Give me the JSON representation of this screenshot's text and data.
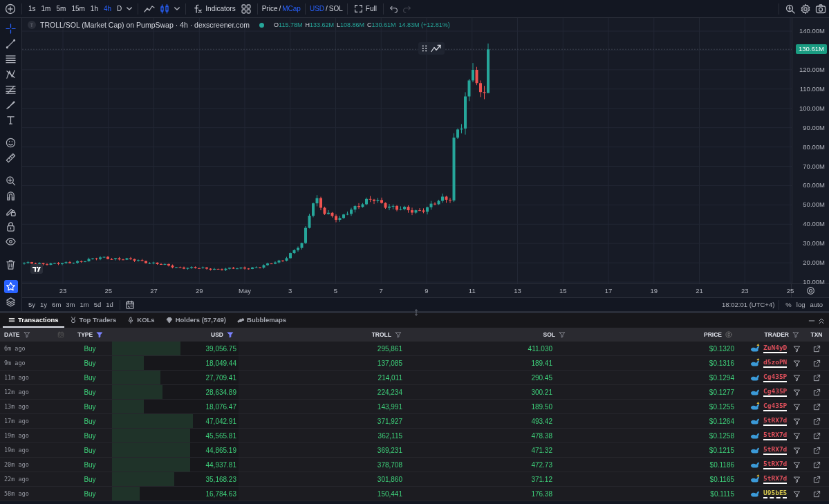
{
  "toolbar": {
    "intervals": [
      {
        "label": "1s",
        "selected": false
      },
      {
        "label": "1m",
        "selected": false
      },
      {
        "label": "5m",
        "selected": false
      },
      {
        "label": "15m",
        "selected": false
      },
      {
        "label": "1h",
        "selected": false
      },
      {
        "label": "4h",
        "selected": true
      },
      {
        "label": "D",
        "selected": false
      }
    ],
    "chart_styles": [
      {
        "kind": "line",
        "selected": false
      },
      {
        "kind": "candles",
        "selected": true
      }
    ],
    "indicators_label": "Indicators",
    "price_mode": [
      {
        "label": "Price",
        "selected": false
      },
      {
        "label": "MCap",
        "selected": true
      }
    ],
    "price_mode_separator": "/",
    "currency": [
      {
        "label": "USD",
        "selected": true
      },
      {
        "label": "SOL",
        "selected": false
      }
    ],
    "currency_separator": "/",
    "fullscreen_label": "Full",
    "redo_disabled": true
  },
  "side_tools": [
    {
      "kind": "crosshair",
      "selected": true
    },
    {
      "kind": "trendline",
      "selected": false
    },
    {
      "kind": "hlines",
      "selected": false
    },
    {
      "kind": "pattern",
      "selected": false
    },
    {
      "kind": "fib",
      "selected": false
    },
    {
      "kind": "brush",
      "selected": false
    },
    {
      "kind": "text",
      "selected": false
    },
    {
      "kind": "emoji",
      "selected": false
    },
    {
      "kind": "ruler",
      "selected": false
    },
    {
      "kind": "zoom",
      "selected": false
    },
    {
      "kind": "magnet",
      "selected": false
    },
    {
      "kind": "lockdraw",
      "selected": false
    },
    {
      "kind": "lock",
      "selected": false
    },
    {
      "kind": "eye",
      "selected": false
    },
    {
      "kind": "trash",
      "selected": false
    },
    {
      "kind": "star",
      "selected": true
    },
    {
      "kind": "layers",
      "selected": false
    }
  ],
  "chart": {
    "symbol_badge": "T",
    "title": "TROLL/SOL (Market Cap) on PumpSwap · 4h · dexscreener.com",
    "market_open": true,
    "ohlc": [
      {
        "label": "O",
        "value": "115.78M"
      },
      {
        "label": "H",
        "value": "133.62M"
      },
      {
        "label": "L",
        "value": "108.86M"
      },
      {
        "label": "C",
        "value": "130.61M"
      }
    ],
    "change": "14.83M (+12.81%)",
    "price_labels": [
      "140.00M",
      "120.00M",
      "110.00M",
      "100.00M",
      "90.00M",
      "80.00M",
      "70.00M",
      "60.00M",
      "50.00M",
      "40.00M",
      "30.00M",
      "20.00M",
      "10.00M"
    ],
    "last_price": "130.61M",
    "time_labels": [
      "23",
      "25",
      "27",
      "29",
      "May",
      "3",
      "5",
      "7",
      "9",
      "11",
      "13",
      "15",
      "17",
      "19",
      "21",
      "23",
      "25"
    ],
    "range_buttons": [
      "5y",
      "1y",
      "6m",
      "3m",
      "1m",
      "5d",
      "1d"
    ],
    "clock": "18:02:01 (UTC+4)",
    "scale_options": [
      "%",
      "log",
      "auto"
    ]
  },
  "panel": {
    "tabs": [
      {
        "label": "Transactions",
        "kind": "list",
        "selected": true
      },
      {
        "label": "Top Traders",
        "kind": "medal",
        "selected": false
      },
      {
        "label": "KOLs",
        "kind": "mic",
        "selected": false
      },
      {
        "label": "Holders (57,749)",
        "kind": "diamond",
        "selected": false
      },
      {
        "label": "Bubblemaps",
        "kind": "bubbles",
        "selected": false
      }
    ],
    "columns": [
      {
        "label": "DATE",
        "kind": "date",
        "filter_active": false
      },
      {
        "label": "TYPE",
        "kind": "filter",
        "filter_active": true
      },
      {
        "label": "USD",
        "kind": "filter",
        "filter_active": true
      },
      {
        "label": "TROLL",
        "kind": "filter",
        "filter_active": false
      },
      {
        "label": "SOL",
        "kind": "filter",
        "filter_active": false
      },
      {
        "label": "PRICE",
        "kind": "currency"
      },
      {
        "label": "TRADER",
        "kind": "filter",
        "filter_active": false
      },
      {
        "label": "TXN",
        "kind": "plain"
      }
    ],
    "rows": [
      {
        "date": "6m ago",
        "type": "Buy",
        "level": 0.54,
        "usd": "39,056.75",
        "troll": "295,861",
        "sol": "411.030",
        "price": "$0.1320",
        "trader": "ZuN4yD",
        "color": "#e0505c",
        "new": true,
        "dashed_underline": false
      },
      {
        "date": "9m ago",
        "type": "Buy",
        "level": 0.25,
        "usd": "18,049.44",
        "troll": "137,085",
        "sol": "189.41",
        "price": "$0.1316",
        "trader": "d5zoPN",
        "color": "#e0505c",
        "new": true,
        "dashed_underline": false
      },
      {
        "date": "11m ago",
        "type": "Buy",
        "level": 0.38,
        "usd": "27,709.41",
        "troll": "214,011",
        "sol": "290.45",
        "price": "$0.1294",
        "trader": "Cg435P",
        "color": "#e0505c",
        "new": false,
        "dashed_underline": false
      },
      {
        "date": "12m ago",
        "type": "Buy",
        "level": 0.4,
        "usd": "28,634.89",
        "troll": "224,234",
        "sol": "300.21",
        "price": "$0.1277",
        "trader": "Cg435P",
        "color": "#e0505c",
        "new": false,
        "dashed_underline": false
      },
      {
        "date": "13m ago",
        "type": "Buy",
        "level": 0.25,
        "usd": "18,076.47",
        "troll": "143,991",
        "sol": "189.50",
        "price": "$0.1255",
        "trader": "Cg435P",
        "color": "#e0505c",
        "new": true,
        "dashed_underline": false
      },
      {
        "date": "17m ago",
        "type": "Buy",
        "level": 0.64,
        "usd": "47,042.91",
        "troll": "371,927",
        "sol": "493.42",
        "price": "$0.1264",
        "trader": "5tRX7d",
        "color": "#e0505c",
        "new": false,
        "dashed_underline": false
      },
      {
        "date": "19m ago",
        "type": "Buy",
        "level": 0.62,
        "usd": "45,565.81",
        "troll": "362,115",
        "sol": "478.38",
        "price": "$0.1258",
        "trader": "5tRX7d",
        "color": "#e0505c",
        "new": false,
        "dashed_underline": false
      },
      {
        "date": "19m ago",
        "type": "Buy",
        "level": 0.62,
        "usd": "44,865.19",
        "troll": "369,231",
        "sol": "471.32",
        "price": "$0.1215",
        "trader": "5tRX7d",
        "color": "#e0505c",
        "new": false,
        "dashed_underline": false
      },
      {
        "date": "20m ago",
        "type": "Buy",
        "level": 0.62,
        "usd": "44,937.81",
        "troll": "378,708",
        "sol": "472.73",
        "price": "$0.1186",
        "trader": "5tRX7d",
        "color": "#e0505c",
        "new": false,
        "dashed_underline": false
      },
      {
        "date": "22m ago",
        "type": "Buy",
        "level": 0.49,
        "usd": "35,168.23",
        "troll": "301,860",
        "sol": "371.12",
        "price": "$0.1165",
        "trader": "5tRX7d",
        "color": "#e0505c",
        "new": true,
        "dashed_underline": false
      },
      {
        "date": "58m ago",
        "type": "Buy",
        "level": 0.22,
        "usd": "16,784.63",
        "troll": "150,441",
        "sol": "176.38",
        "price": "$0.1115",
        "trader": "U95bE5",
        "color": "#d6c84e",
        "new": false,
        "dashed_underline": true
      }
    ]
  }
}
